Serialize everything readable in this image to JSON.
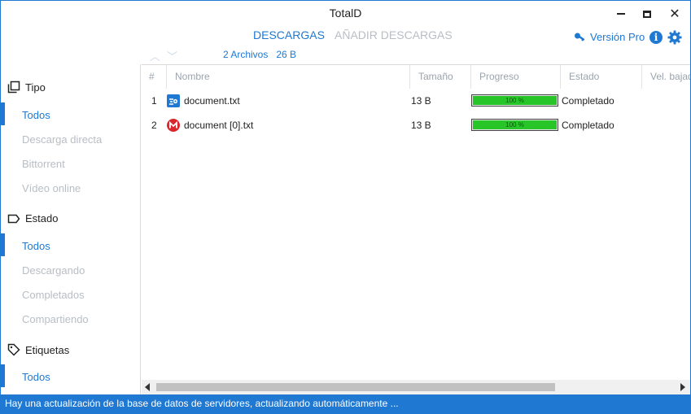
{
  "window": {
    "title": "TotalD"
  },
  "tabs": [
    {
      "label": "DESCARGAS",
      "active": true
    },
    {
      "label": "AÑADIR DESCARGAS",
      "active": false
    }
  ],
  "header": {
    "pro_label": "Versión Pro"
  },
  "summary": {
    "files": "2 Archivos",
    "size": "26 B"
  },
  "sidebar": {
    "type": {
      "label": "Tipo",
      "items": [
        "Todos",
        "Descarga directa",
        "Bittorrent",
        "Vídeo online"
      ]
    },
    "state": {
      "label": "Estado",
      "items": [
        "Todos",
        "Descargando",
        "Completados",
        "Compartiendo"
      ]
    },
    "tags": {
      "label": "Etiquetas",
      "items": [
        "Todos"
      ]
    }
  },
  "table": {
    "columns": [
      "#",
      "Nombre",
      "Tamaño",
      "Progreso",
      "Estado",
      "Vel. bajada"
    ],
    "rows": [
      {
        "index": "1",
        "name": "document.txt",
        "icon": "mediafire-icon",
        "size": "13 B",
        "progress": 100,
        "progress_label": "100 %",
        "status": "Completado"
      },
      {
        "index": "2",
        "name": "document [0].txt",
        "icon": "mega-icon",
        "size": "13 B",
        "progress": 100,
        "progress_label": "100 %",
        "status": "Completado"
      }
    ]
  },
  "statusbar": {
    "text": "Hay una actualización de la base de datos de servidores, actualizando automáticamente ..."
  },
  "colors": {
    "accent": "#1f78d1",
    "progress": "#28c528",
    "mega": "#d9272e"
  }
}
